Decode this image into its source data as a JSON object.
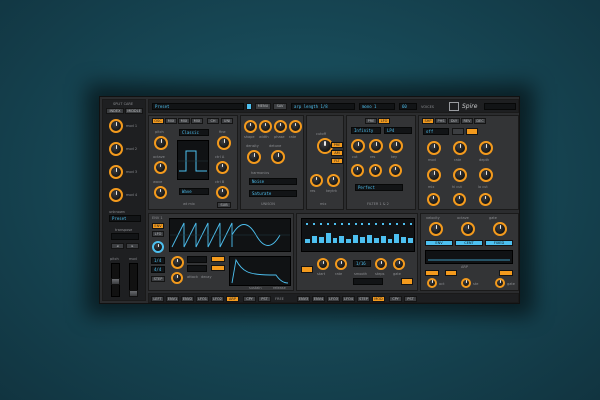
{
  "colors": {
    "background": "#174856",
    "panel": "#2b2c2e",
    "accent_orange": "#f39a1d",
    "accent_blue": "#4dc0f0"
  },
  "left": {
    "header": "SPLIT CARE",
    "buttons": [
      "INDEX",
      "MIDDLE"
    ],
    "knobs": [
      "mod 1",
      "mod 2",
      "mod 3",
      "mod 4"
    ],
    "preset_label": "unknown",
    "preset_display": "Preset",
    "transpose": "transpose",
    "pitch": "pitch",
    "mod": "mod"
  },
  "top": {
    "preset_name": "Preset",
    "menu": "MENU",
    "save": "SAV",
    "arp_display": "arp length 1/8",
    "mono_display": "mono 1",
    "seq_display": "60",
    "voices": "VOICES",
    "logo": "Spire"
  },
  "osc": {
    "tabs": [
      "OSC",
      "MIX",
      "MIX",
      "MIX",
      "CH",
      "UNI"
    ],
    "labels": [
      "pitch",
      "fine",
      "octave",
      "wave",
      "ctrl A",
      "ctrl B",
      "wt mix"
    ],
    "mode": "Classic",
    "wave": "Wave",
    "sub": "SUB"
  },
  "fx": {
    "knobs_top": [
      "shape",
      "width",
      "phase",
      "rate"
    ],
    "labels": [
      "density",
      "detune",
      "harmonics"
    ],
    "mode_a": "Noise",
    "mode_b": "Saturate",
    "group": "UNISON"
  },
  "mix": {
    "labels": [
      "cutoff",
      "res",
      "keytrk",
      "mix"
    ],
    "buttons": [
      "PRE",
      "AM",
      "FLT"
    ]
  },
  "filter": {
    "tabs": [
      "PRE",
      "LFO"
    ],
    "display_a": "Infinity",
    "display_b": "LP4",
    "mode": "Perfect",
    "title": "FILTER 1 & 2",
    "labels": [
      "cut",
      "res",
      "key",
      "env"
    ]
  },
  "right": {
    "tabs": [
      "SHP",
      "PHS",
      "DLY",
      "REV",
      "DEC"
    ],
    "display": "off",
    "labels": [
      "mod",
      "rate",
      "depth",
      "mix",
      "hi cut",
      "lo cut"
    ]
  },
  "env": {
    "section": "ENV 1",
    "buttons": [
      "ENV",
      "LFO",
      "STEP",
      "MTRX"
    ],
    "display_a": "1/4",
    "display_b": "4/4",
    "labels": [
      "attack",
      "decay",
      "sustain",
      "release"
    ]
  },
  "seq": {
    "labels": [
      "start",
      "rate",
      "smooth",
      "steps",
      "gate"
    ],
    "display": "1/16",
    "steps": [
      0.35,
      0.6,
      0.5,
      0.8,
      0.45,
      0.55,
      0.3,
      0.7,
      0.5,
      0.65,
      0.4,
      0.6,
      0.35,
      0.75,
      0.5,
      0.45
    ]
  },
  "arp": {
    "tabs": [
      "ENV",
      "CENT",
      "FIXED"
    ],
    "labels": [
      "velocity",
      "octave",
      "gate"
    ],
    "section": "ARP",
    "footer": [
      "oct",
      "ste",
      "gate"
    ]
  },
  "bottom": {
    "left": [
      "LEFT",
      "ENV1",
      "ENV2",
      "LFO1",
      "LFO2",
      "ARP",
      "CPY",
      "PST",
      "FREE"
    ],
    "right": [
      "ENV3",
      "ENV4",
      "LFO3",
      "LFO4",
      "STEP",
      "MOD",
      "CPY",
      "PST"
    ]
  }
}
